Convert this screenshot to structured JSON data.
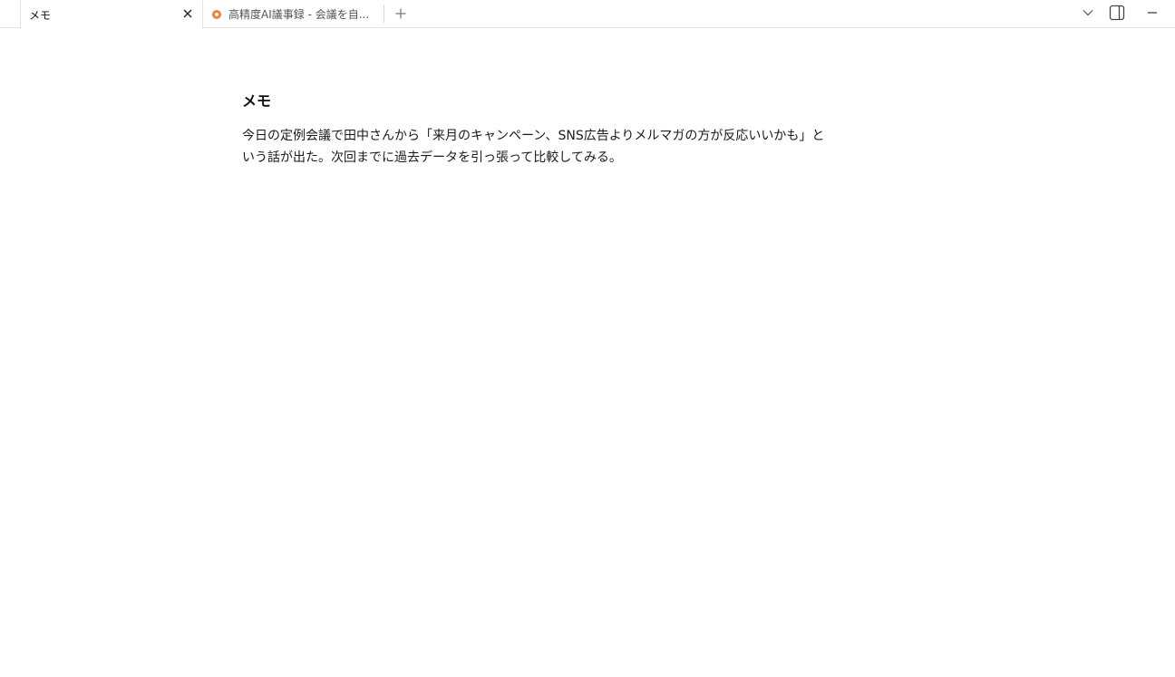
{
  "tabs": [
    {
      "title": "メモ",
      "active": true,
      "close_icon": "close-icon"
    },
    {
      "title": "高精度AI議事録 - 会議を自...",
      "active": false,
      "favicon": "orange-circle-favicon",
      "favicon_color": "#f0803c"
    }
  ],
  "window_controls": {
    "tab_list_icon": "chevron-down-icon",
    "sidebar_icon": "sidebar-panel-icon",
    "minimize_icon": "minimize-icon"
  },
  "note": {
    "title": "メモ",
    "body": "今日の定例会議で田中さんから「来月のキャンペーン、SNS広告よりメルマガの方が反応いいかも」という話が出た。次回までに過去データを引っ張って比較してみる。"
  }
}
